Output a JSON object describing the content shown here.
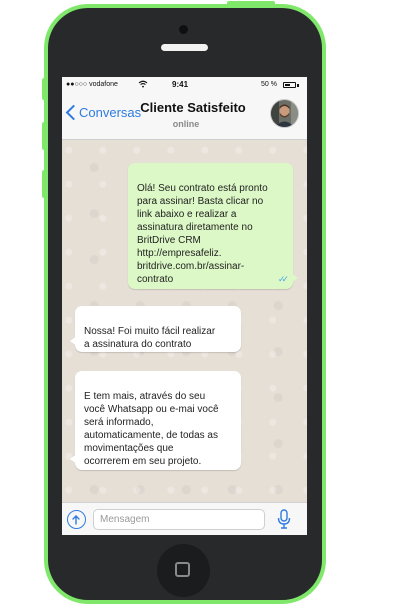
{
  "status_bar": {
    "carrier": "●●○○○ vodafone",
    "wifi_icon": "wifi-icon",
    "time": "9:41",
    "battery_percent": "50 %",
    "battery_icon": "battery-icon"
  },
  "header": {
    "back_label": "Conversas",
    "contact_name": "Cliente Satisfeito",
    "contact_status": "online"
  },
  "messages": [
    {
      "direction": "outgoing",
      "text": "Olá! Seu contrato está pronto\npara assinar! Basta clicar no\nlink abaixo e realizar a\nassinatura diretamente no\nBritDrive CRM\nhttp://empresafeliz.\nbritdrive.com.br/assinar-\ncontrato",
      "status_icon": "double-check-icon"
    },
    {
      "direction": "incoming",
      "text": "Nossa! Foi muito fácil realizar\na assinatura do contrato"
    },
    {
      "direction": "incoming",
      "text": "E tem mais, através do seu\nvocê Whatsapp ou e-mai você\nserá informado,\nautomaticamente, de todas as\nmovimentações que\nocorrerem em seu projeto."
    }
  ],
  "input_bar": {
    "placeholder": "Mensagem",
    "value": ""
  },
  "colors": {
    "accent": "#2f7be0",
    "outgoing_bubble": "#dcf8c6",
    "incoming_bubble": "#ffffff",
    "phone_frame": "#7fe86a",
    "phone_body": "#27292b"
  }
}
